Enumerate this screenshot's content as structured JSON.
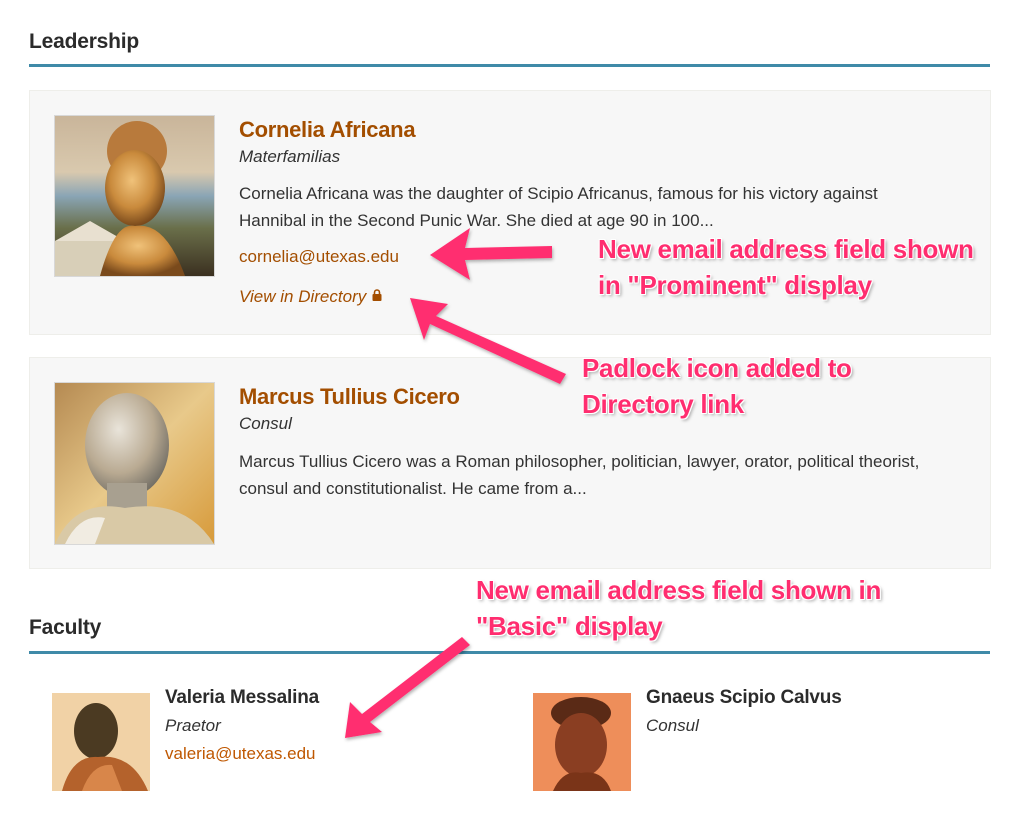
{
  "sections": {
    "leadership": {
      "title": "Leadership",
      "people": [
        {
          "name": "Cornelia Africana",
          "role": "Materfamilias",
          "bio": "Cornelia Africana was the daughter of Scipio Africanus, famous for his victory against Hannibal in the Second Punic War. She died at age 90 in 100...",
          "email": "cornelia@utexas.edu",
          "directory_link": "View in Directory",
          "directory_icon": "padlock-icon"
        },
        {
          "name": "Marcus Tullius Cicero",
          "role": "Consul",
          "bio": "Marcus Tullius Cicero was a Roman philosopher, politician, lawyer, orator, political theorist, consul and constitutionalist. He came from a..."
        }
      ]
    },
    "faculty": {
      "title": "Faculty",
      "people": [
        {
          "name": "Valeria Messalina",
          "role": "Praetor",
          "email": "valeria@utexas.edu"
        },
        {
          "name": "Gnaeus Scipio Calvus",
          "role": "Consul"
        }
      ]
    }
  },
  "annotations": {
    "prominent_email": [
      "New email address field shown",
      "in \"Prominent\" display"
    ],
    "padlock": [
      "Padlock icon added to",
      "Directory link"
    ],
    "basic_email": [
      "New email address field shown in",
      "\"Basic\" display"
    ]
  },
  "colors": {
    "accent_rule": "#3f8aa8",
    "link": "#a34e00",
    "basic_email": "#bf5700",
    "annotation": "#ff2d6f",
    "card_bg": "#f7f7f7"
  }
}
